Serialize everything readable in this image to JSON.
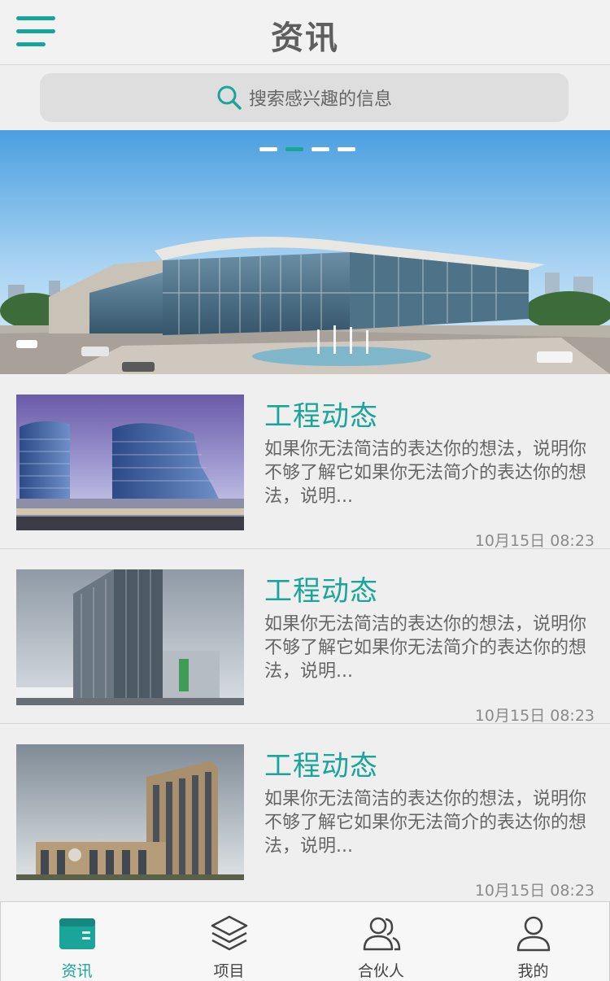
{
  "header": {
    "title": "资讯"
  },
  "search": {
    "placeholder": "搜索感兴趣的信息"
  },
  "banner": {
    "slide_count": 4,
    "active_slide": 2
  },
  "news": [
    {
      "title": "工程动态",
      "summary": "如果你无法简洁的表达你的想法，说明你不够了解它如果你无法简介的表达你的想法，说明...",
      "time": "10月15日 08:23"
    },
    {
      "title": "工程动态",
      "summary": "如果你无法简洁的表达你的想法，说明你不够了解它如果你无法简介的表达你的想法，说明...",
      "time": "10月15日 08:23"
    },
    {
      "title": "工程动态",
      "summary": "如果你无法简洁的表达你的想法，说明你不够了解它如果你无法简介的表达你的想法，说明...",
      "time": "10月15日 08:23"
    }
  ],
  "tabs": [
    {
      "label": "资讯",
      "icon": "news-icon",
      "active": true
    },
    {
      "label": "项目",
      "icon": "layers-icon",
      "active": false
    },
    {
      "label": "合伙人",
      "icon": "partners-icon",
      "active": false
    },
    {
      "label": "我的",
      "icon": "user-icon",
      "active": false
    }
  ],
  "colors": {
    "accent": "#19a59a",
    "background": "#efefef",
    "text": "#5a5a5a"
  }
}
